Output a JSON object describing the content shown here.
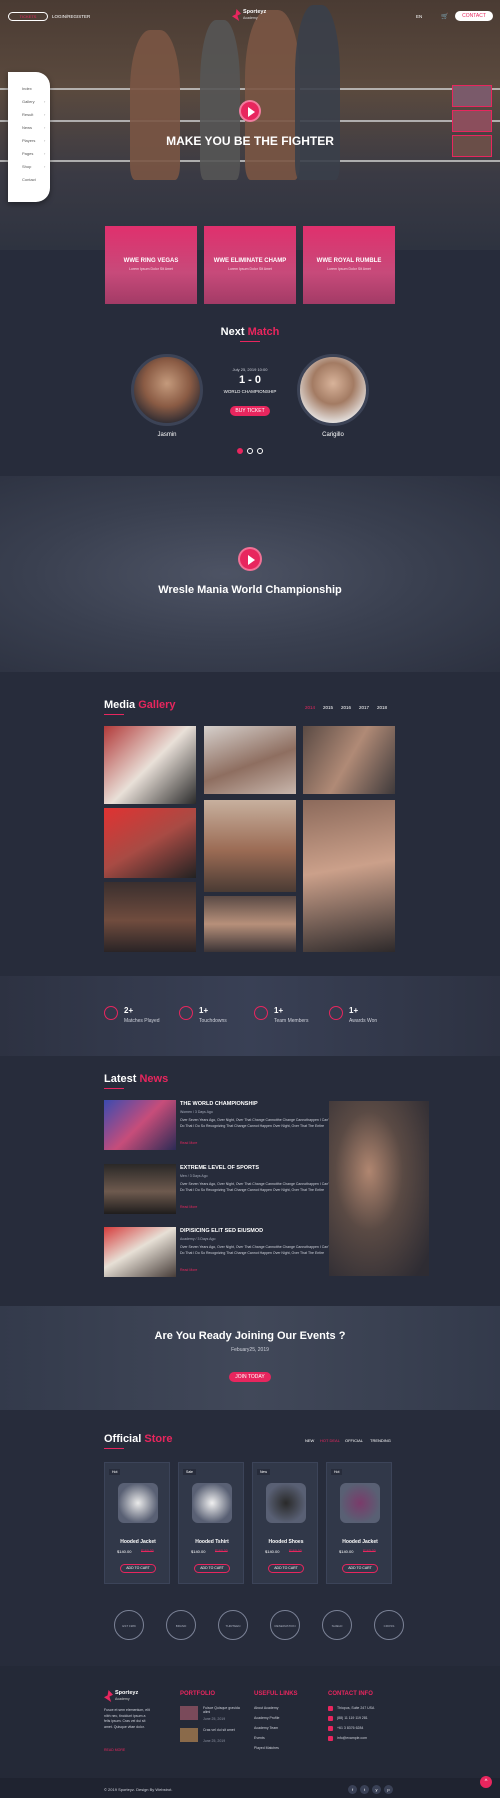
{
  "header": {
    "tickets_label": "TICKETS",
    "login_label": "LOGIN/REGISTER",
    "brand": "Sporteyz",
    "brand_sub": "Academy",
    "lang": "EN",
    "contact_label": "CONTACT"
  },
  "menu": [
    "Index",
    "Gallery",
    "Result",
    "News",
    "Players",
    "Pages",
    "Shop",
    "Contact"
  ],
  "hero": {
    "title": "MAKE YOU BE THE FIGHTER"
  },
  "cards": [
    {
      "title": "WWE RING VEGAS",
      "sub": "Lorem Ipsum Dolor Sit Amet"
    },
    {
      "title": "WWE ELIMINATE CHAMP",
      "sub": "Lorem Ipsum Dolor Sit Amet"
    },
    {
      "title": "WWE ROYAL RUMBLE",
      "sub": "Lorem Ipsum Dolor Sit Amet"
    }
  ],
  "next_match": {
    "title_a": "Next",
    "title_b": "Match",
    "date": "July 25, 2019 10:00",
    "score": "1 - 0",
    "event": "WORLD CHAMPIONSHIP",
    "buy_label": "BUY TICKET",
    "player1": "Jasmin",
    "player2": "Carigillo"
  },
  "banner": {
    "title": "Wresle Mania World Championship"
  },
  "gallery": {
    "title_a": "Media",
    "title_b": "Gallery",
    "years": [
      "2014",
      "2015",
      "2016",
      "2017",
      "2018"
    ]
  },
  "stats": [
    {
      "num": "2+",
      "label": "Matches Played"
    },
    {
      "num": "1+",
      "label": "Touchdowns"
    },
    {
      "num": "1+",
      "label": "Team Members"
    },
    {
      "num": "1+",
      "label": "Awards Won"
    }
  ],
  "news": {
    "title_a": "Latest",
    "title_b": "News",
    "items": [
      {
        "title": "THE WORLD CHAMPIONSHIP",
        "meta": "Women / 3 Days Ago",
        "desc": "Over Seven Years Ago, Over Night, Over That Change Cannotthe Change Cannothappen I Can't Do That I Do So Recognizing That Change Cannot Happen Over Night, Over That The Entire",
        "more": "Read More"
      },
      {
        "title": "EXTREME LEVEL OF SPORTS",
        "meta": "Men / 3 Days Ago",
        "desc": "Over Seven Years Ago, Over Night, Over That Change Cannotthe Change Cannothappen I Can't Do That I Do So Recognizing That Change Cannot Happen Over Night, Over That The Entire",
        "more": "Read More"
      },
      {
        "title": "DIPISICING ELIT SED EIUSMOD",
        "meta": "Academy / 3 Days Ago",
        "desc": "Over Seven Years Ago, Over Night, Over That Change Cannotthe Change Cannothappen I Can't Do That I Do So Recognizing That Change Cannot Happen Over Night, Over That The Entire",
        "more": "Read More"
      }
    ]
  },
  "events": {
    "title": "Are You Ready Joining Our Events ?",
    "date": "Febuary25, 2019",
    "join_label": "JOIN TODAY"
  },
  "store": {
    "title_a": "Official",
    "title_b": "Store",
    "tabs": [
      "NEW",
      "HOT DEAL",
      "OFFICIAL",
      "TRENDING"
    ],
    "products": [
      {
        "badge": "Hot",
        "name": "Hooded Jacket",
        "price": "$140.00",
        "old": "$160.00",
        "btn": "ADD TO CART"
      },
      {
        "badge": "Sale",
        "name": "Hooded Tshirt",
        "price": "$140.00",
        "old": "$160.00",
        "btn": "ADD TO CART"
      },
      {
        "badge": "New",
        "name": "Hooded Shoes",
        "price": "$140.00",
        "old": "$160.00",
        "btn": "ADD TO CART"
      },
      {
        "badge": "Hot",
        "name": "Hooded Jacket",
        "price": "$140.00",
        "old": "$160.00",
        "btn": "ADD TO CART"
      }
    ],
    "partners": [
      "EST 1989",
      "BRAND",
      "THIRTEEN",
      "RESERVATION",
      "SHIELD",
      "CROSS"
    ]
  },
  "footer": {
    "brand": "Sporteyz",
    "brand_sub": "Academy",
    "about": "Fusce et sem elementum, elit nibh nec, tincidunt ipsum a felis ipsum. Cras vel dui sit amet. Quisque vitae dolor.",
    "read_more": "READ MORE",
    "portfolio_title": "PORTFOLIO",
    "portfolio": [
      {
        "title": "Fuisce Quisque gravida alimi",
        "date": "June 25, 2019"
      },
      {
        "title": "Cras vel dui sit amet",
        "date": "June 25, 2019"
      }
    ],
    "links_title": "USEFUL LINKS",
    "links": [
      "About Academy",
      "Academy Profile",
      "Academy Team",
      "Events",
      "Played Matches"
    ],
    "contact_title": "CONTACT INFO",
    "contact": [
      "Thiopus, Suite 247 USA",
      "(88) 11 119 119 281",
      "+61 3 8376 6284",
      "info@example.com"
    ],
    "copyright": "© 2019 Sporteyz. Design By Webstrot.",
    "social": [
      "f",
      "t",
      "y",
      "p"
    ]
  },
  "colors": {
    "accent": "#e8265e",
    "bg": "#272c3b",
    "card_bg": "#313849"
  }
}
